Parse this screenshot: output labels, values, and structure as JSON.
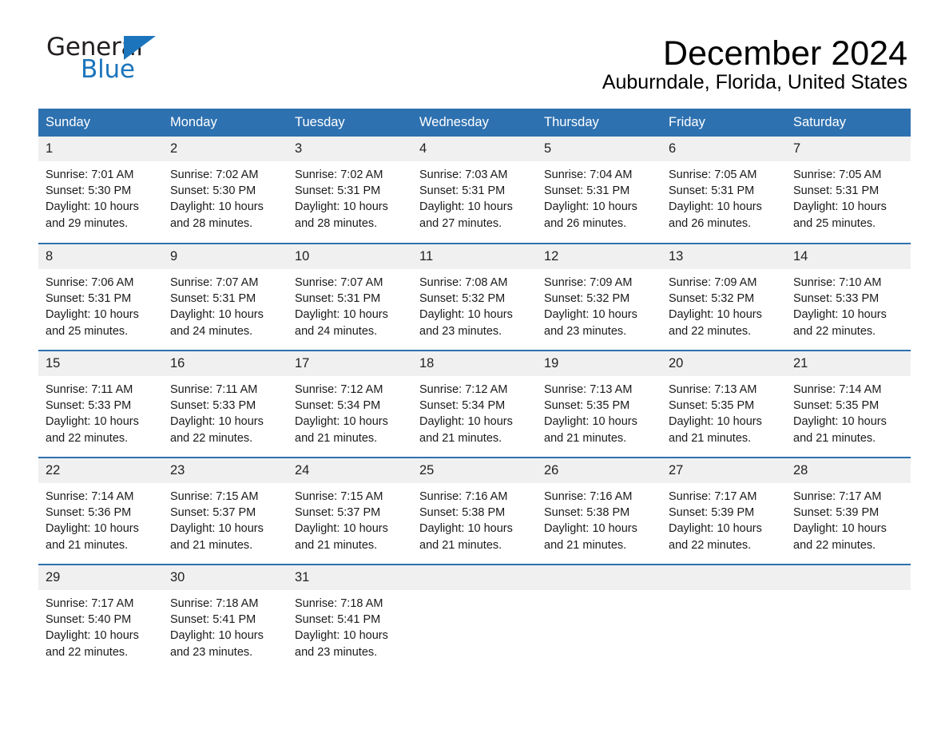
{
  "brand": {
    "name_part1": "General",
    "name_part2": "Blue",
    "accent_color": "#1c75bc"
  },
  "header": {
    "title": "December 2024",
    "location": "Auburndale, Florida, United States"
  },
  "theme": {
    "header_blue": "#2e71b0",
    "daynum_band": "#f0f0f0"
  },
  "calendar": {
    "weekday_headers": [
      "Sunday",
      "Monday",
      "Tuesday",
      "Wednesday",
      "Thursday",
      "Friday",
      "Saturday"
    ],
    "weeks": [
      [
        {
          "day": "1",
          "sunrise": "Sunrise: 7:01 AM",
          "sunset": "Sunset: 5:30 PM",
          "daylight_line1": "Daylight: 10 hours",
          "daylight_line2": "and 29 minutes."
        },
        {
          "day": "2",
          "sunrise": "Sunrise: 7:02 AM",
          "sunset": "Sunset: 5:30 PM",
          "daylight_line1": "Daylight: 10 hours",
          "daylight_line2": "and 28 minutes."
        },
        {
          "day": "3",
          "sunrise": "Sunrise: 7:02 AM",
          "sunset": "Sunset: 5:31 PM",
          "daylight_line1": "Daylight: 10 hours",
          "daylight_line2": "and 28 minutes."
        },
        {
          "day": "4",
          "sunrise": "Sunrise: 7:03 AM",
          "sunset": "Sunset: 5:31 PM",
          "daylight_line1": "Daylight: 10 hours",
          "daylight_line2": "and 27 minutes."
        },
        {
          "day": "5",
          "sunrise": "Sunrise: 7:04 AM",
          "sunset": "Sunset: 5:31 PM",
          "daylight_line1": "Daylight: 10 hours",
          "daylight_line2": "and 26 minutes."
        },
        {
          "day": "6",
          "sunrise": "Sunrise: 7:05 AM",
          "sunset": "Sunset: 5:31 PM",
          "daylight_line1": "Daylight: 10 hours",
          "daylight_line2": "and 26 minutes."
        },
        {
          "day": "7",
          "sunrise": "Sunrise: 7:05 AM",
          "sunset": "Sunset: 5:31 PM",
          "daylight_line1": "Daylight: 10 hours",
          "daylight_line2": "and 25 minutes."
        }
      ],
      [
        {
          "day": "8",
          "sunrise": "Sunrise: 7:06 AM",
          "sunset": "Sunset: 5:31 PM",
          "daylight_line1": "Daylight: 10 hours",
          "daylight_line2": "and 25 minutes."
        },
        {
          "day": "9",
          "sunrise": "Sunrise: 7:07 AM",
          "sunset": "Sunset: 5:31 PM",
          "daylight_line1": "Daylight: 10 hours",
          "daylight_line2": "and 24 minutes."
        },
        {
          "day": "10",
          "sunrise": "Sunrise: 7:07 AM",
          "sunset": "Sunset: 5:31 PM",
          "daylight_line1": "Daylight: 10 hours",
          "daylight_line2": "and 24 minutes."
        },
        {
          "day": "11",
          "sunrise": "Sunrise: 7:08 AM",
          "sunset": "Sunset: 5:32 PM",
          "daylight_line1": "Daylight: 10 hours",
          "daylight_line2": "and 23 minutes."
        },
        {
          "day": "12",
          "sunrise": "Sunrise: 7:09 AM",
          "sunset": "Sunset: 5:32 PM",
          "daylight_line1": "Daylight: 10 hours",
          "daylight_line2": "and 23 minutes."
        },
        {
          "day": "13",
          "sunrise": "Sunrise: 7:09 AM",
          "sunset": "Sunset: 5:32 PM",
          "daylight_line1": "Daylight: 10 hours",
          "daylight_line2": "and 22 minutes."
        },
        {
          "day": "14",
          "sunrise": "Sunrise: 7:10 AM",
          "sunset": "Sunset: 5:33 PM",
          "daylight_line1": "Daylight: 10 hours",
          "daylight_line2": "and 22 minutes."
        }
      ],
      [
        {
          "day": "15",
          "sunrise": "Sunrise: 7:11 AM",
          "sunset": "Sunset: 5:33 PM",
          "daylight_line1": "Daylight: 10 hours",
          "daylight_line2": "and 22 minutes."
        },
        {
          "day": "16",
          "sunrise": "Sunrise: 7:11 AM",
          "sunset": "Sunset: 5:33 PM",
          "daylight_line1": "Daylight: 10 hours",
          "daylight_line2": "and 22 minutes."
        },
        {
          "day": "17",
          "sunrise": "Sunrise: 7:12 AM",
          "sunset": "Sunset: 5:34 PM",
          "daylight_line1": "Daylight: 10 hours",
          "daylight_line2": "and 21 minutes."
        },
        {
          "day": "18",
          "sunrise": "Sunrise: 7:12 AM",
          "sunset": "Sunset: 5:34 PM",
          "daylight_line1": "Daylight: 10 hours",
          "daylight_line2": "and 21 minutes."
        },
        {
          "day": "19",
          "sunrise": "Sunrise: 7:13 AM",
          "sunset": "Sunset: 5:35 PM",
          "daylight_line1": "Daylight: 10 hours",
          "daylight_line2": "and 21 minutes."
        },
        {
          "day": "20",
          "sunrise": "Sunrise: 7:13 AM",
          "sunset": "Sunset: 5:35 PM",
          "daylight_line1": "Daylight: 10 hours",
          "daylight_line2": "and 21 minutes."
        },
        {
          "day": "21",
          "sunrise": "Sunrise: 7:14 AM",
          "sunset": "Sunset: 5:35 PM",
          "daylight_line1": "Daylight: 10 hours",
          "daylight_line2": "and 21 minutes."
        }
      ],
      [
        {
          "day": "22",
          "sunrise": "Sunrise: 7:14 AM",
          "sunset": "Sunset: 5:36 PM",
          "daylight_line1": "Daylight: 10 hours",
          "daylight_line2": "and 21 minutes."
        },
        {
          "day": "23",
          "sunrise": "Sunrise: 7:15 AM",
          "sunset": "Sunset: 5:37 PM",
          "daylight_line1": "Daylight: 10 hours",
          "daylight_line2": "and 21 minutes."
        },
        {
          "day": "24",
          "sunrise": "Sunrise: 7:15 AM",
          "sunset": "Sunset: 5:37 PM",
          "daylight_line1": "Daylight: 10 hours",
          "daylight_line2": "and 21 minutes."
        },
        {
          "day": "25",
          "sunrise": "Sunrise: 7:16 AM",
          "sunset": "Sunset: 5:38 PM",
          "daylight_line1": "Daylight: 10 hours",
          "daylight_line2": "and 21 minutes."
        },
        {
          "day": "26",
          "sunrise": "Sunrise: 7:16 AM",
          "sunset": "Sunset: 5:38 PM",
          "daylight_line1": "Daylight: 10 hours",
          "daylight_line2": "and 21 minutes."
        },
        {
          "day": "27",
          "sunrise": "Sunrise: 7:17 AM",
          "sunset": "Sunset: 5:39 PM",
          "daylight_line1": "Daylight: 10 hours",
          "daylight_line2": "and 22 minutes."
        },
        {
          "day": "28",
          "sunrise": "Sunrise: 7:17 AM",
          "sunset": "Sunset: 5:39 PM",
          "daylight_line1": "Daylight: 10 hours",
          "daylight_line2": "and 22 minutes."
        }
      ],
      [
        {
          "day": "29",
          "sunrise": "Sunrise: 7:17 AM",
          "sunset": "Sunset: 5:40 PM",
          "daylight_line1": "Daylight: 10 hours",
          "daylight_line2": "and 22 minutes."
        },
        {
          "day": "30",
          "sunrise": "Sunrise: 7:18 AM",
          "sunset": "Sunset: 5:41 PM",
          "daylight_line1": "Daylight: 10 hours",
          "daylight_line2": "and 23 minutes."
        },
        {
          "day": "31",
          "sunrise": "Sunrise: 7:18 AM",
          "sunset": "Sunset: 5:41 PM",
          "daylight_line1": "Daylight: 10 hours",
          "daylight_line2": "and 23 minutes."
        },
        {
          "day": "",
          "sunrise": "",
          "sunset": "",
          "daylight_line1": "",
          "daylight_line2": "",
          "empty": true
        },
        {
          "day": "",
          "sunrise": "",
          "sunset": "",
          "daylight_line1": "",
          "daylight_line2": "",
          "empty": true
        },
        {
          "day": "",
          "sunrise": "",
          "sunset": "",
          "daylight_line1": "",
          "daylight_line2": "",
          "empty": true
        },
        {
          "day": "",
          "sunrise": "",
          "sunset": "",
          "daylight_line1": "",
          "daylight_line2": "",
          "empty": true
        }
      ]
    ]
  }
}
